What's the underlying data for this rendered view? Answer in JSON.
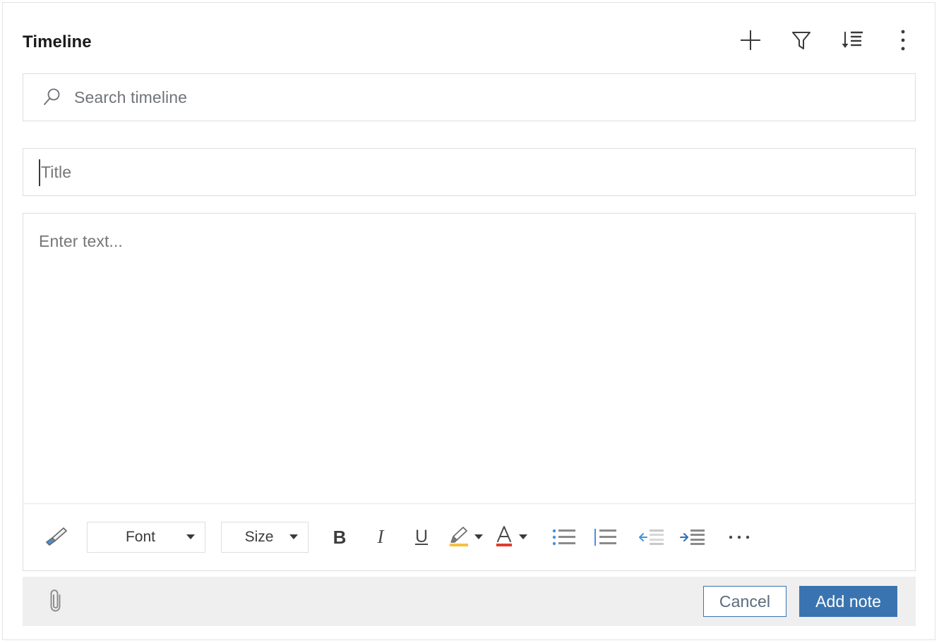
{
  "panel": {
    "title": "Timeline"
  },
  "header": {
    "actions": [
      {
        "name": "add-record-button",
        "icon": "plus-icon",
        "label": "Add record"
      },
      {
        "name": "filter-button",
        "icon": "funnel-icon",
        "label": "Filter"
      },
      {
        "name": "sort-button",
        "icon": "sort-descending-icon",
        "label": "Sort"
      },
      {
        "name": "more-commands-button",
        "icon": "vertical-ellipsis-icon",
        "label": "More commands"
      }
    ]
  },
  "search": {
    "placeholder": "Search timeline",
    "value": "",
    "icon": "search-icon"
  },
  "note": {
    "title_placeholder": "Title",
    "title_value": "",
    "body_placeholder": "Enter text...",
    "body_value": ""
  },
  "format_toolbar": {
    "format_painter": {
      "label": "Format painter",
      "icon": "paintbrush-icon"
    },
    "font": {
      "label": "Font",
      "value": "Font"
    },
    "size": {
      "label": "Size",
      "value": "Size"
    },
    "bold": {
      "label": "B"
    },
    "italic": {
      "label": "I"
    },
    "underline": {
      "label": "U"
    },
    "highlight": {
      "label": "Text highlight color",
      "icon": "highlighter-icon",
      "color": "#f5c242"
    },
    "font_color": {
      "label": "Font color",
      "icon": "font-color-icon",
      "color": "#e03a2f"
    },
    "bulleted_list": {
      "label": "Bulleted list",
      "icon": "bulleted-list-icon"
    },
    "numbered_list": {
      "label": "Numbered list",
      "icon": "numbered-list-icon"
    },
    "decrease_indent": {
      "label": "Decrease indent",
      "icon": "decrease-indent-icon"
    },
    "increase_indent": {
      "label": "Increase indent",
      "icon": "increase-indent-icon"
    },
    "more_options": {
      "label": "More formatting options",
      "icon": "horizontal-ellipsis-icon"
    }
  },
  "footer": {
    "attach": {
      "label": "Attach file",
      "icon": "paperclip-icon"
    },
    "cancel_label": "Cancel",
    "submit_label": "Add note"
  },
  "colors": {
    "accent": "#3a74b0",
    "icon_blue": "#2f6fad",
    "border": "#dedede",
    "footer_bg": "#efefef",
    "title_text": "#1b1b1b",
    "placeholder_text": "#767676"
  }
}
